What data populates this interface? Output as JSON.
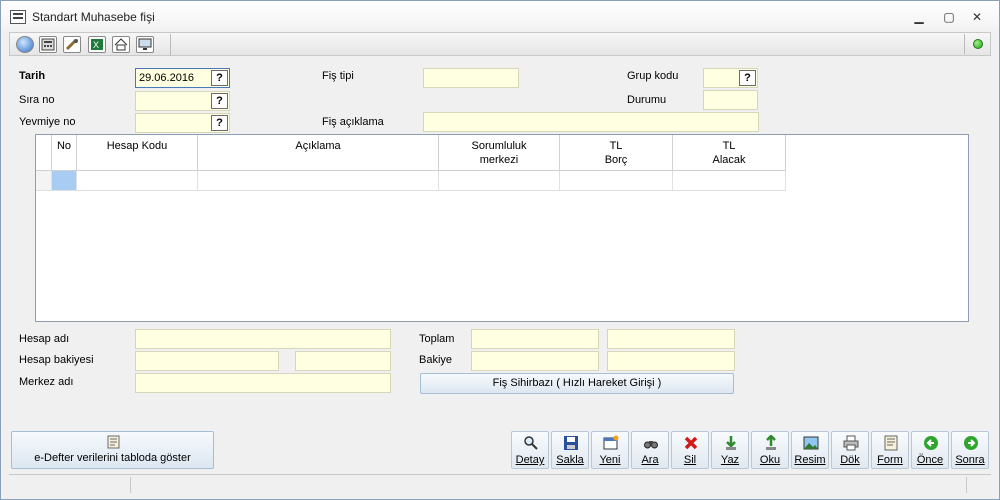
{
  "window": {
    "title": "Standart Muhasebe fişi"
  },
  "toolbar": {
    "icons": [
      "help-icon",
      "calculator-icon",
      "tools-icon",
      "excel-icon",
      "home-icon",
      "screen-icon"
    ],
    "status_color": "#24a31a"
  },
  "form": {
    "tarih_label": "Tarih",
    "tarih_value": "29.06.2016",
    "sira_label": "Sıra no",
    "yevmiye_label": "Yevmiye no",
    "fis_tipi_label": "Fiş tipi",
    "fis_aciklama_label": "Fiş açıklama",
    "grup_kodu_label": "Grup kodu",
    "durumu_label": "Durumu",
    "lookup_btn": "?"
  },
  "grid": {
    "columns": [
      {
        "label": "No"
      },
      {
        "label": "Hesap Kodu"
      },
      {
        "label": "Açıklama"
      },
      {
        "label": "Sorumluluk\nmerkezi"
      },
      {
        "label": "TL\nBorç"
      },
      {
        "label": "TL\nAlacak"
      }
    ]
  },
  "bottom_form": {
    "hesap_adi_label": "Hesap adı",
    "hesap_bakiyesi_label": "Hesap bakiyesi",
    "merkez_adi_label": "Merkez adı",
    "toplam_label": "Toplam",
    "bakiye_label": "Bakiye",
    "sihirbaz_button": "Fiş Sihirbazı ( Hızlı Hareket Girişi )"
  },
  "actions": {
    "edefter_button": "e-Defter verilerini tabloda göster",
    "buttons": [
      {
        "label": "Detay",
        "icon": "magnifier-icon"
      },
      {
        "label": "Sakla",
        "icon": "floppy-icon"
      },
      {
        "label": "Yeni",
        "icon": "new-window-icon"
      },
      {
        "label": "Ara",
        "icon": "binoculars-icon"
      },
      {
        "label": "Sil",
        "icon": "delete-x-icon"
      },
      {
        "label": "Yaz",
        "icon": "write-arrow-icon"
      },
      {
        "label": "Oku",
        "icon": "read-arrow-icon"
      },
      {
        "label": "Resim",
        "icon": "picture-icon"
      },
      {
        "label": "Dök",
        "icon": "printer-icon"
      },
      {
        "label": "Form",
        "icon": "form-icon"
      },
      {
        "label": "Önce",
        "icon": "arrow-left-icon"
      },
      {
        "label": "Sonra",
        "icon": "arrow-right-icon"
      }
    ]
  }
}
